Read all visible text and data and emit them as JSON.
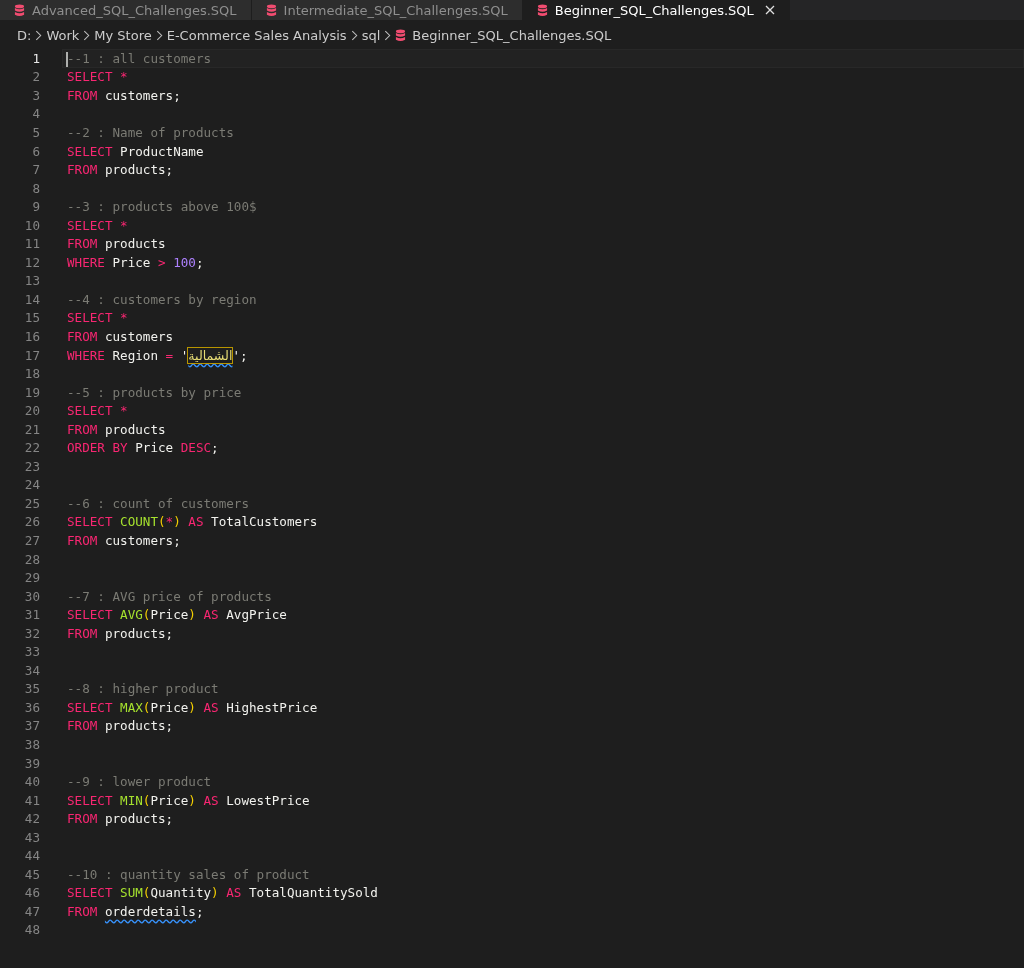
{
  "tabs": [
    {
      "label": "Advanced_SQL_Challenges.SQL",
      "selected": false
    },
    {
      "label": "Intermediate_SQL_Challenges.SQL",
      "selected": false
    },
    {
      "label": "Beginner_SQL_Challenges.SQL",
      "selected": true
    }
  ],
  "breadcrumb": [
    {
      "label": "D:",
      "kind": "folder"
    },
    {
      "label": "Work",
      "kind": "folder"
    },
    {
      "label": "My Store",
      "kind": "folder"
    },
    {
      "label": "E-Commerce Sales Analysis",
      "kind": "folder"
    },
    {
      "label": "sql",
      "kind": "folder"
    },
    {
      "label": "Beginner_SQL_Challenges.SQL",
      "kind": "file"
    }
  ],
  "lines": [
    {
      "number": "1",
      "current": true,
      "tokens": [
        {
          "kind": "comment",
          "text": "--1 : all customers"
        }
      ]
    },
    {
      "number": "2",
      "current": false,
      "tokens": [
        {
          "kind": "keyword",
          "text": "SELECT"
        },
        {
          "kind": "operator",
          "text": " *"
        }
      ]
    },
    {
      "number": "3",
      "current": false,
      "tokens": [
        {
          "kind": "keyword",
          "text": "FROM"
        },
        {
          "kind": "plain",
          "text": " customers;"
        }
      ]
    },
    {
      "number": "4",
      "current": false
    },
    {
      "number": "5",
      "current": false,
      "tokens": [
        {
          "kind": "comment",
          "text": "--2 : Name of products"
        }
      ]
    },
    {
      "number": "6",
      "current": false,
      "tokens": [
        {
          "kind": "keyword",
          "text": "SELECT"
        },
        {
          "kind": "plain",
          "text": " ProductName"
        }
      ]
    },
    {
      "number": "7",
      "current": false,
      "tokens": [
        {
          "kind": "keyword",
          "text": "FROM"
        },
        {
          "kind": "plain",
          "text": " products;"
        }
      ]
    },
    {
      "number": "8",
      "current": false
    },
    {
      "number": "9",
      "current": false,
      "tokens": [
        {
          "kind": "comment",
          "text": "--3 : products above 100$"
        }
      ]
    },
    {
      "number": "10",
      "current": false,
      "tokens": [
        {
          "kind": "keyword",
          "text": "SELECT"
        },
        {
          "kind": "operator",
          "text": " *"
        }
      ]
    },
    {
      "number": "11",
      "current": false,
      "tokens": [
        {
          "kind": "keyword",
          "text": "FROM"
        },
        {
          "kind": "plain",
          "text": " products"
        }
      ]
    },
    {
      "number": "12",
      "current": false,
      "tokens": [
        {
          "kind": "keyword",
          "text": "WHERE"
        },
        {
          "kind": "plain",
          "text": " Price "
        },
        {
          "kind": "operator",
          "text": ">"
        },
        {
          "kind": "number",
          "text": " 100"
        },
        {
          "kind": "plain",
          "text": ";"
        }
      ]
    },
    {
      "number": "13",
      "current": false
    },
    {
      "number": "14",
      "current": false,
      "tokens": [
        {
          "kind": "comment",
          "text": "--4 : customers by region"
        }
      ]
    },
    {
      "number": "15",
      "current": false,
      "tokens": [
        {
          "kind": "keyword",
          "text": "SELECT"
        },
        {
          "kind": "operator",
          "text": " *"
        }
      ]
    },
    {
      "number": "16",
      "current": false,
      "tokens": [
        {
          "kind": "keyword",
          "text": "FROM"
        },
        {
          "kind": "plain",
          "text": " customers"
        }
      ]
    },
    {
      "number": "17",
      "current": false,
      "tokens": [
        {
          "kind": "keyword",
          "text": "WHERE"
        },
        {
          "kind": "plain",
          "text": " Region "
        },
        {
          "kind": "operator",
          "text": "="
        },
        {
          "kind": "plain",
          "text": " '"
        },
        {
          "kind": "string",
          "text": "الشمالية",
          "highlight": true,
          "squiggle": true
        },
        {
          "kind": "plain",
          "text": "';"
        }
      ]
    },
    {
      "number": "18",
      "current": false
    },
    {
      "number": "19",
      "current": false,
      "tokens": [
        {
          "kind": "comment",
          "text": "--5 : products by price"
        }
      ]
    },
    {
      "number": "20",
      "current": false,
      "tokens": [
        {
          "kind": "keyword",
          "text": "SELECT"
        },
        {
          "kind": "operator",
          "text": " *"
        }
      ]
    },
    {
      "number": "21",
      "current": false,
      "tokens": [
        {
          "kind": "keyword",
          "text": "FROM"
        },
        {
          "kind": "plain",
          "text": " products"
        }
      ]
    },
    {
      "number": "22",
      "current": false,
      "tokens": [
        {
          "kind": "keyword",
          "text": "ORDER BY"
        },
        {
          "kind": "plain",
          "text": " Price "
        },
        {
          "kind": "keyword",
          "text": "DESC"
        },
        {
          "kind": "plain",
          "text": ";"
        }
      ]
    },
    {
      "number": "23",
      "current": false
    },
    {
      "number": "24",
      "current": false
    },
    {
      "number": "25",
      "current": false,
      "tokens": [
        {
          "kind": "comment",
          "text": "--6 : count of customers"
        }
      ]
    },
    {
      "number": "26",
      "current": false,
      "tokens": [
        {
          "kind": "keyword",
          "text": "SELECT"
        },
        {
          "kind": "function",
          "text": " COUNT"
        },
        {
          "kind": "paren",
          "text": "("
        },
        {
          "kind": "operator",
          "text": "*"
        },
        {
          "kind": "paren",
          "text": ")"
        },
        {
          "kind": "keyword",
          "text": " AS"
        },
        {
          "kind": "plain",
          "text": " TotalCustomers"
        }
      ]
    },
    {
      "number": "27",
      "current": false,
      "tokens": [
        {
          "kind": "keyword",
          "text": "FROM"
        },
        {
          "kind": "plain",
          "text": " customers;"
        }
      ]
    },
    {
      "number": "28",
      "current": false
    },
    {
      "number": "29",
      "current": false
    },
    {
      "number": "30",
      "current": false,
      "tokens": [
        {
          "kind": "comment",
          "text": "--7 : AVG price of products"
        }
      ]
    },
    {
      "number": "31",
      "current": false,
      "tokens": [
        {
          "kind": "keyword",
          "text": "SELECT"
        },
        {
          "kind": "function",
          "text": " AVG"
        },
        {
          "kind": "paren",
          "text": "("
        },
        {
          "kind": "plain",
          "text": "Price"
        },
        {
          "kind": "paren",
          "text": ")"
        },
        {
          "kind": "keyword",
          "text": " AS"
        },
        {
          "kind": "plain",
          "text": " AvgPrice"
        }
      ]
    },
    {
      "number": "32",
      "current": false,
      "tokens": [
        {
          "kind": "keyword",
          "text": "FROM"
        },
        {
          "kind": "plain",
          "text": " products;"
        }
      ]
    },
    {
      "number": "33",
      "current": false
    },
    {
      "number": "34",
      "current": false
    },
    {
      "number": "35",
      "current": false,
      "tokens": [
        {
          "kind": "comment",
          "text": "--8 : higher product"
        }
      ]
    },
    {
      "number": "36",
      "current": false,
      "tokens": [
        {
          "kind": "keyword",
          "text": "SELECT"
        },
        {
          "kind": "function",
          "text": " MAX"
        },
        {
          "kind": "paren",
          "text": "("
        },
        {
          "kind": "plain",
          "text": "Price"
        },
        {
          "kind": "paren",
          "text": ")"
        },
        {
          "kind": "keyword",
          "text": " AS"
        },
        {
          "kind": "plain",
          "text": " HighestPrice"
        }
      ]
    },
    {
      "number": "37",
      "current": false,
      "tokens": [
        {
          "kind": "keyword",
          "text": "FROM"
        },
        {
          "kind": "plain",
          "text": " products;"
        }
      ]
    },
    {
      "number": "38",
      "current": false
    },
    {
      "number": "39",
      "current": false
    },
    {
      "number": "40",
      "current": false,
      "tokens": [
        {
          "kind": "comment",
          "text": "--9 : lower product"
        }
      ]
    },
    {
      "number": "41",
      "current": false,
      "tokens": [
        {
          "kind": "keyword",
          "text": "SELECT"
        },
        {
          "kind": "function",
          "text": " MIN"
        },
        {
          "kind": "paren",
          "text": "("
        },
        {
          "kind": "plain",
          "text": "Price"
        },
        {
          "kind": "paren",
          "text": ")"
        },
        {
          "kind": "keyword",
          "text": " AS"
        },
        {
          "kind": "plain",
          "text": " LowestPrice"
        }
      ]
    },
    {
      "number": "42",
      "current": false,
      "tokens": [
        {
          "kind": "keyword",
          "text": "FROM"
        },
        {
          "kind": "plain",
          "text": " products;"
        }
      ]
    },
    {
      "number": "43",
      "current": false
    },
    {
      "number": "44",
      "current": false
    },
    {
      "number": "45",
      "current": false,
      "tokens": [
        {
          "kind": "comment",
          "text": "--10 : quantity sales of product"
        }
      ]
    },
    {
      "number": "46",
      "current": false,
      "tokens": [
        {
          "kind": "keyword",
          "text": "SELECT"
        },
        {
          "kind": "function",
          "text": " SUM"
        },
        {
          "kind": "paren",
          "text": "("
        },
        {
          "kind": "plain",
          "text": "Quantity"
        },
        {
          "kind": "paren",
          "text": ")"
        },
        {
          "kind": "keyword",
          "text": " AS"
        },
        {
          "kind": "plain",
          "text": " TotalQuantitySold"
        }
      ]
    },
    {
      "number": "47",
      "current": false,
      "tokens": [
        {
          "kind": "keyword",
          "text": "FROM "
        },
        {
          "kind": "plain",
          "text": "orderdetails",
          "squiggle": true
        },
        {
          "kind": "plain",
          "text": ";"
        }
      ]
    },
    {
      "number": "48",
      "current": false
    }
  ]
}
